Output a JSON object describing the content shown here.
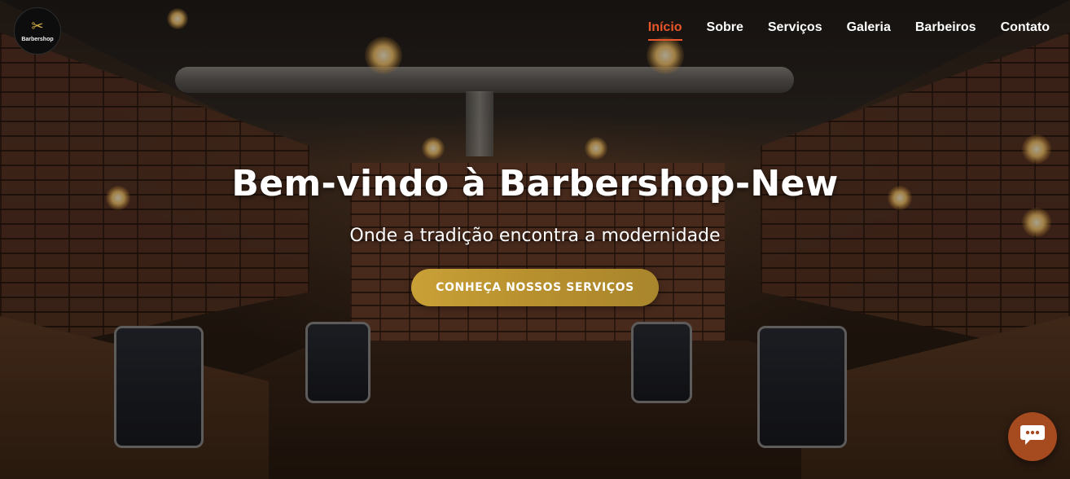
{
  "brand": {
    "logo_text": "Barbershop",
    "logo_icon": "scissors-razor-icon"
  },
  "nav": {
    "items": [
      {
        "label": "Início",
        "active": true
      },
      {
        "label": "Sobre",
        "active": false
      },
      {
        "label": "Serviços",
        "active": false
      },
      {
        "label": "Galeria",
        "active": false
      },
      {
        "label": "Barbeiros",
        "active": false
      },
      {
        "label": "Contato",
        "active": false
      }
    ]
  },
  "hero": {
    "title": "Bem-vindo à Barbershop-New",
    "subtitle": "Onde a tradição encontra a modernidade",
    "cta_label": "CONHEÇA NOSSOS SERVIÇOS"
  },
  "chat": {
    "icon": "chat-icon"
  },
  "colors": {
    "accent": "#e8562a",
    "cta_gold": "#c9a037",
    "chat_bubble": "#a64a1f"
  }
}
